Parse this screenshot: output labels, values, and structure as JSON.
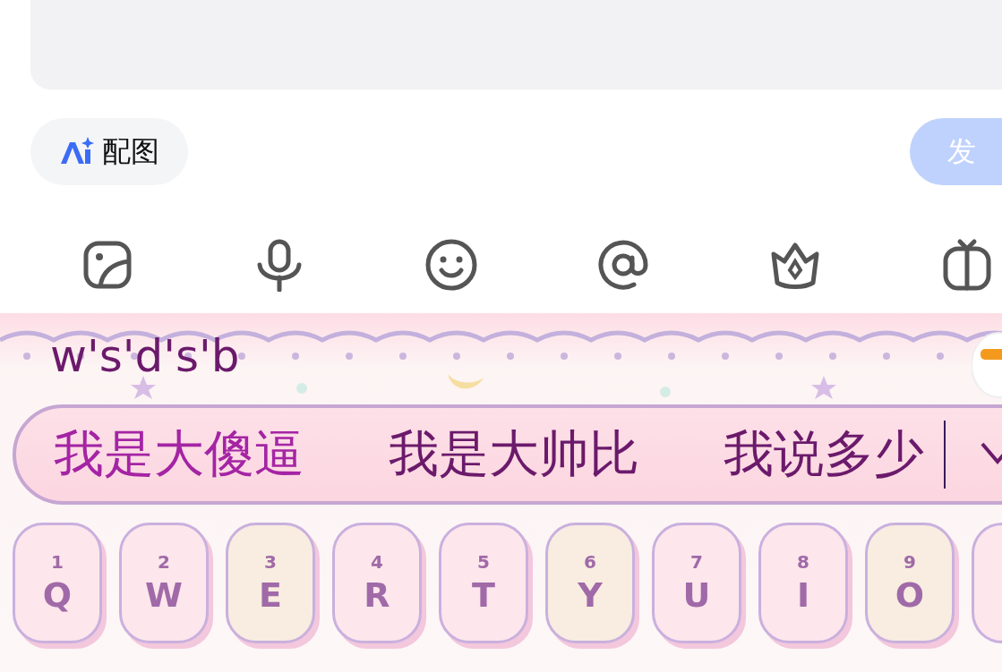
{
  "composer": {
    "ai_image_button": "配图",
    "post_button": "发"
  },
  "toolbar": [
    {
      "kind": "image"
    },
    {
      "kind": "mic"
    },
    {
      "kind": "emoji"
    },
    {
      "kind": "mention"
    },
    {
      "kind": "crown"
    },
    {
      "kind": "gift"
    }
  ],
  "keyboard": {
    "composition": "w's'd's'b",
    "candidates": [
      {
        "text": "我是大傻逼",
        "selected": true
      },
      {
        "text": "我是大帅比",
        "selected": false
      },
      {
        "text": "我说多少",
        "selected": false
      }
    ],
    "keys": [
      {
        "number": "1",
        "letter": "Q",
        "color": "#fde6ec"
      },
      {
        "number": "2",
        "letter": "W",
        "color": "#fde6ec"
      },
      {
        "number": "3",
        "letter": "E",
        "color": "#f8ede0"
      },
      {
        "number": "4",
        "letter": "R",
        "color": "#fde6ec"
      },
      {
        "number": "5",
        "letter": "T",
        "color": "#fde6ec"
      },
      {
        "number": "6",
        "letter": "Y",
        "color": "#f8ede0"
      },
      {
        "number": "7",
        "letter": "U",
        "color": "#fde6ec"
      },
      {
        "number": "8",
        "letter": "I",
        "color": "#fde6ec"
      },
      {
        "number": "9",
        "letter": "O",
        "color": "#f8ede0"
      }
    ]
  }
}
